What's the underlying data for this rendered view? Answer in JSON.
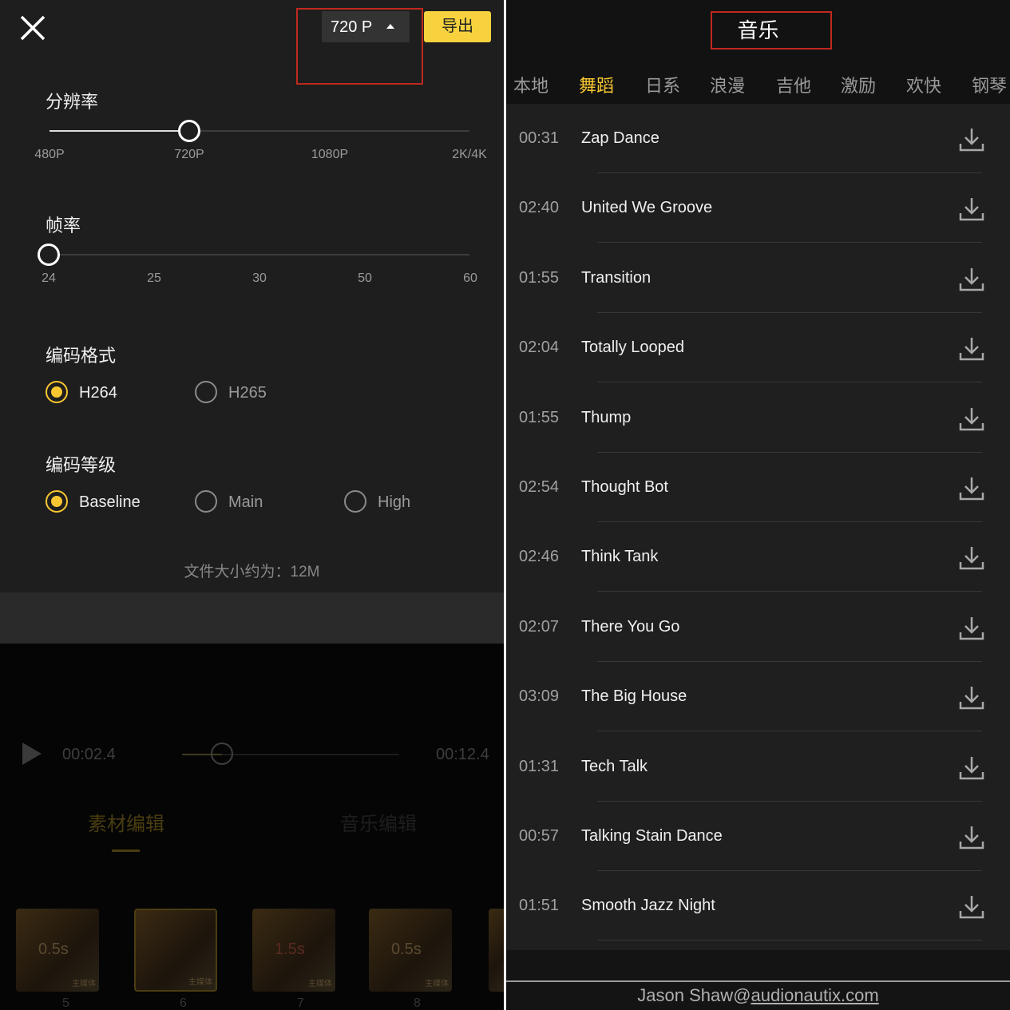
{
  "left": {
    "export_dialog": {
      "resolution_dropdown": "720 P",
      "export_button": "导出",
      "resolution": {
        "label": "分辨率",
        "ticks": [
          "480P",
          "720P",
          "1080P",
          "2K/4K"
        ],
        "selected_index": 1
      },
      "frame_rate": {
        "label": "帧率",
        "ticks": [
          "24",
          "25",
          "30",
          "50",
          "60"
        ],
        "selected_index": 0
      },
      "codec": {
        "label": "编码格式",
        "options": [
          "H264",
          "H265"
        ],
        "selected": "H264"
      },
      "profile": {
        "label": "编码等级",
        "options": [
          "Baseline",
          "Main",
          "High"
        ],
        "selected": "Baseline"
      },
      "file_size": "文件大小约为：12M"
    },
    "player": {
      "current_time": "00:02.4",
      "total_time": "00:12.4",
      "progress": 0.19
    },
    "edit_tabs": [
      "素材编辑",
      "音乐编辑"
    ],
    "clips": [
      {
        "number": "5",
        "duration": "0.5s",
        "tag": "主媒体"
      },
      {
        "number": "6",
        "duration": "",
        "tag": "主媒体"
      },
      {
        "number": "7",
        "duration": "1.5s",
        "tag": "主媒体"
      },
      {
        "number": "8",
        "duration": "0.5s",
        "tag": "主媒体"
      }
    ]
  },
  "right": {
    "title": "音乐",
    "categories": [
      "本地",
      "舞蹈",
      "日系",
      "浪漫",
      "吉他",
      "激励",
      "欢快",
      "钢琴"
    ],
    "active_category": "舞蹈",
    "tracks": [
      {
        "duration": "00:31",
        "name": "Zap Dance"
      },
      {
        "duration": "02:40",
        "name": "United We Groove"
      },
      {
        "duration": "01:55",
        "name": "Transition"
      },
      {
        "duration": "02:04",
        "name": "Totally Looped"
      },
      {
        "duration": "01:55",
        "name": "Thump"
      },
      {
        "duration": "02:54",
        "name": "Thought Bot"
      },
      {
        "duration": "02:46",
        "name": "Think Tank"
      },
      {
        "duration": "02:07",
        "name": "There You Go"
      },
      {
        "duration": "03:09",
        "name": "The Big House"
      },
      {
        "duration": "01:31",
        "name": "Tech Talk"
      },
      {
        "duration": "00:57",
        "name": "Talking Stain Dance"
      },
      {
        "duration": "01:51",
        "name": "Smooth Jazz Night"
      }
    ],
    "credit_author": "Jason Shaw@",
    "credit_link": "audionautix.com"
  },
  "colors": {
    "accent": "#f7c630",
    "annotation_box": "#c0281e"
  }
}
